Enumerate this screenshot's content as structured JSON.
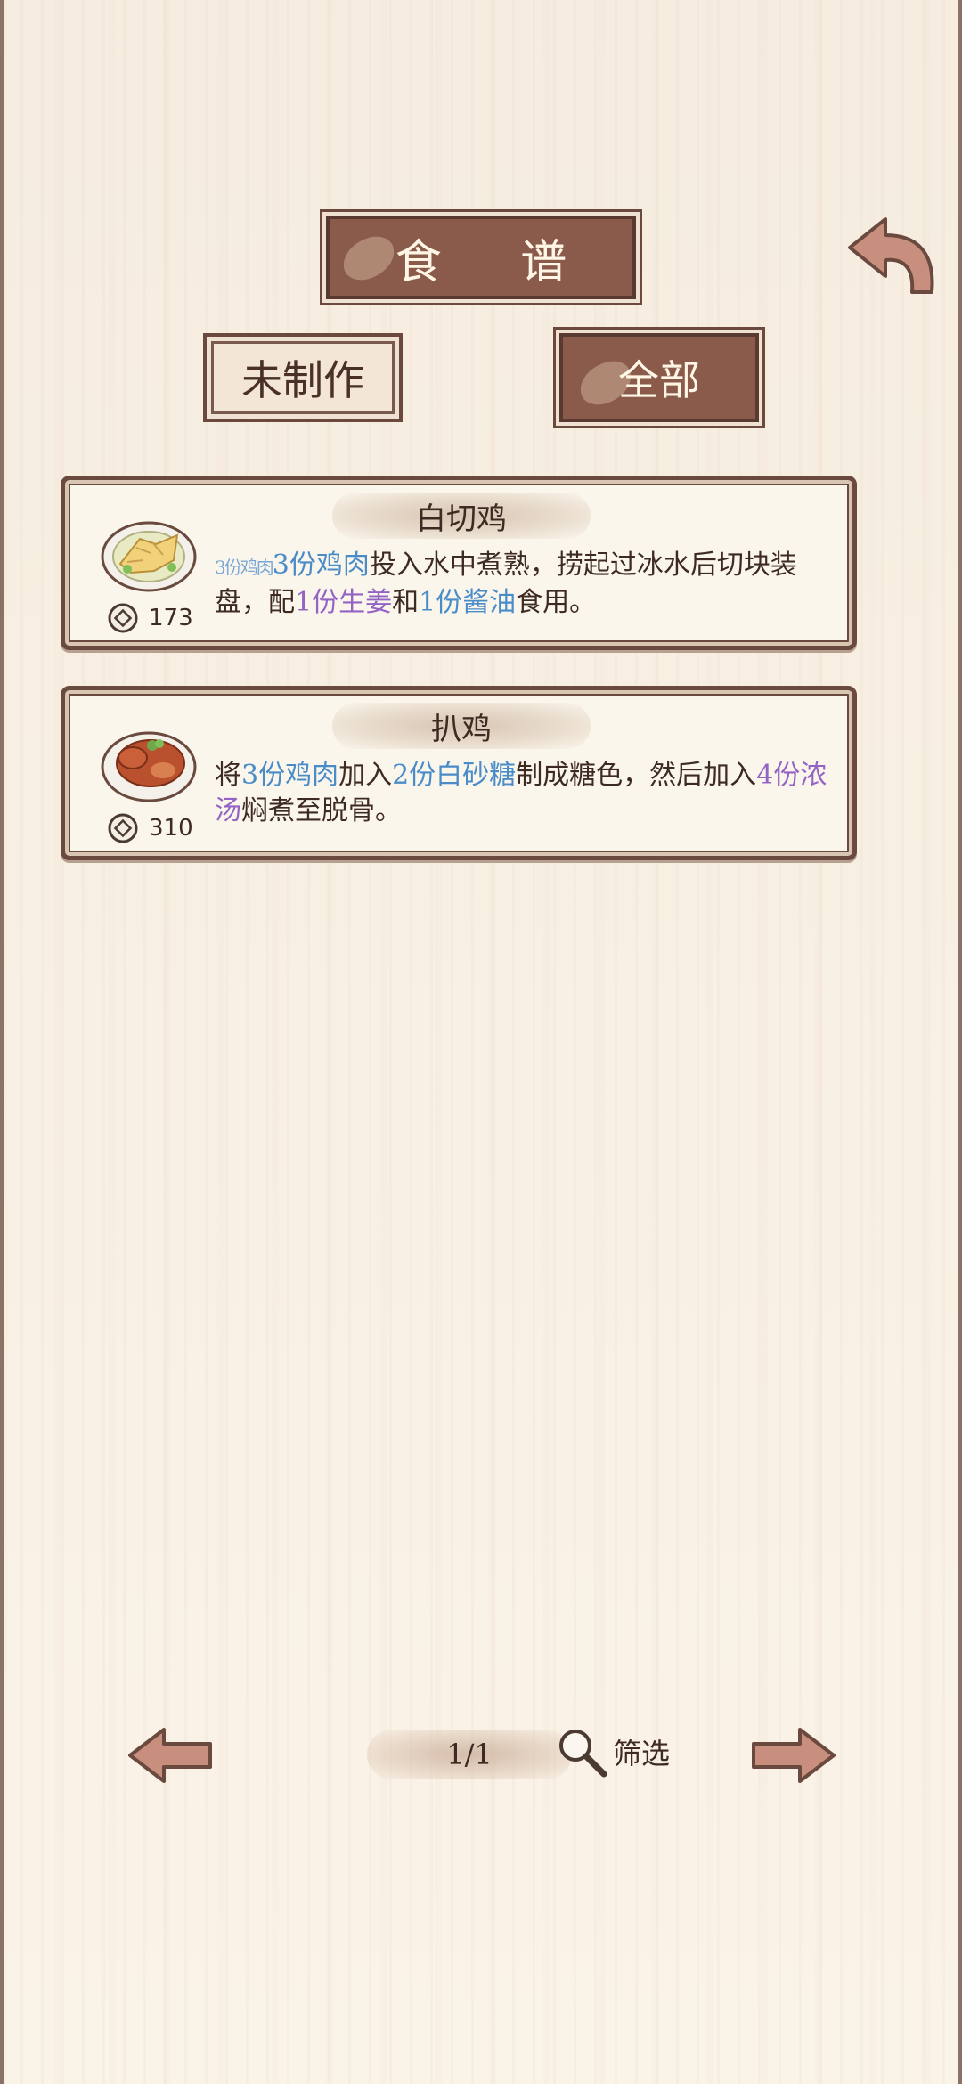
{
  "header": {
    "title": "食 谱"
  },
  "tabs": [
    {
      "label": "未制作"
    },
    {
      "label": "全部"
    }
  ],
  "recipes": [
    {
      "name": "白切鸡",
      "price": "173",
      "description": {
        "prefix_faint": "3份鸡肉",
        "p1": "3份鸡肉",
        "p2": "投入水中煮熟，捞起过冰水后切块装盘，配",
        "p3": "1份生姜",
        "p4": "和",
        "p5": "1份酱油",
        "p6": "食用。"
      }
    },
    {
      "name": "扒鸡",
      "price": "310",
      "description": {
        "p0": "将",
        "p1": "3份鸡肉",
        "p2": "加入",
        "p3": "2份白砂糖",
        "p4": "制成糖色，然后加入",
        "p5": "4份浓汤",
        "p6": "焖煮至脱骨。"
      }
    }
  ],
  "pagination": {
    "page": "1/1",
    "filter_label": "筛选"
  },
  "icons": {
    "back": "back-arrow-icon",
    "prev": "left-arrow-icon",
    "next": "right-arrow-icon",
    "coin": "coin-icon",
    "filter": "magnifier-icon"
  },
  "colors": {
    "plaque": "#8a5a4a",
    "ingredient_blue": "#4a8cc8",
    "ingredient_purple": "#9464c4",
    "arrow": "#c98f7e"
  }
}
